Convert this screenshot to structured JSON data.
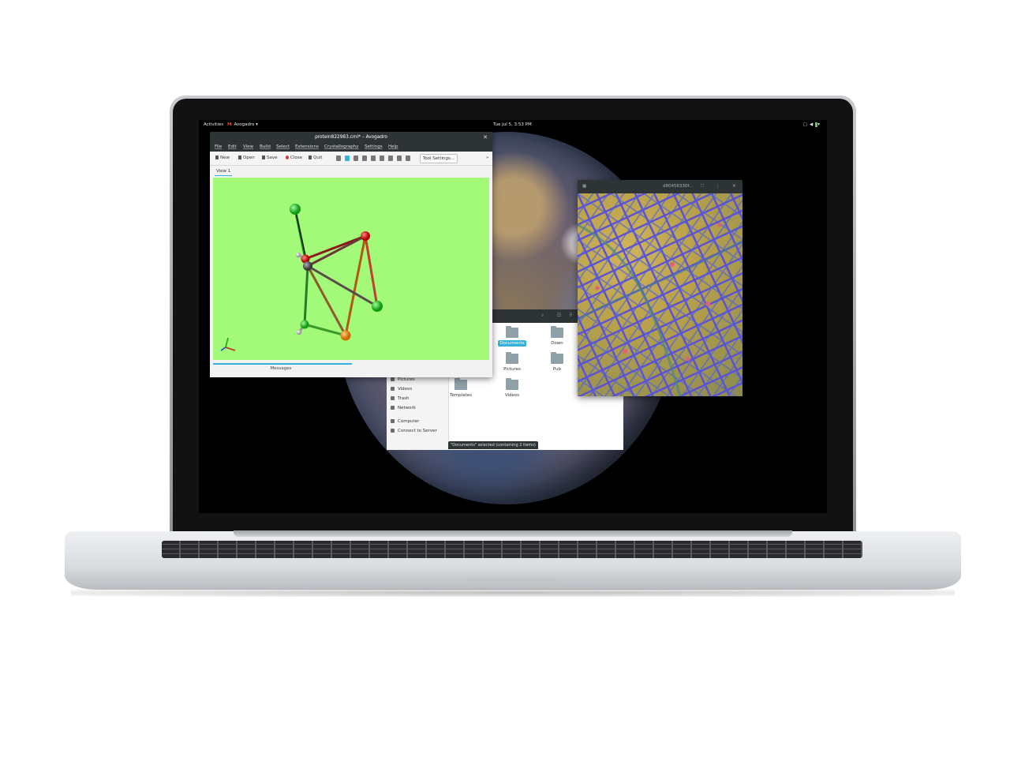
{
  "topbar": {
    "activities": "Activities",
    "app_name": "Avogadro",
    "clock": "Tue Jul 5,  3:53 PM"
  },
  "avogadro": {
    "title": "protein822983.cml* – Avogadro",
    "menu": [
      "File",
      "Edit",
      "View",
      "Build",
      "Select",
      "Extensions",
      "Crystallography",
      "Settings",
      "Help"
    ],
    "toolbar": {
      "new": "New",
      "open": "Open",
      "save": "Save",
      "close": "Close",
      "quit": "Quit",
      "tool_settings": "Tool Settings..."
    },
    "tab": "View 1",
    "messages": "Messages",
    "viewport_color": "#a2fa78"
  },
  "files": {
    "sidebar": [
      "Pictures",
      "Videos",
      "Trash",
      "Network",
      "Computer",
      "Connect to Server"
    ],
    "items": [
      {
        "label": "Documents",
        "selected": true
      },
      {
        "label": "Down",
        "selected": false
      },
      {
        "label": "Pictures",
        "selected": false
      },
      {
        "label": "Pub",
        "selected": false
      },
      {
        "label": "Templates",
        "selected": false
      },
      {
        "label": "Videos",
        "selected": false
      }
    ],
    "status": "\"Documents\" selected  (containing 2 items)"
  },
  "image_viewer": {
    "title": "d80456330f..."
  },
  "colors": {
    "accent": "#33b3dc",
    "header": "#2e3436"
  }
}
